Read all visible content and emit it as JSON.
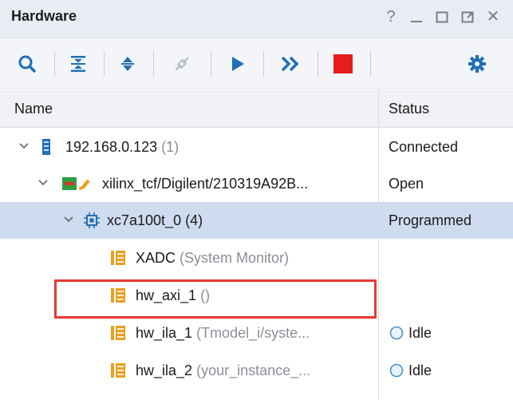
{
  "panel": {
    "title": "Hardware",
    "controls": [
      "help-icon",
      "minimize-icon",
      "maximize-icon",
      "float-icon",
      "close-icon"
    ],
    "control_glyphs": {
      "help": "?",
      "close": "✕"
    }
  },
  "toolbar": {
    "buttons": [
      "search-icon",
      "collapse-all-icon",
      "expand-all-icon",
      "auto-connect-icon",
      "run-trigger-icon",
      "run-trigger-immediate-icon",
      "stop-trigger-icon",
      "settings-icon"
    ]
  },
  "columns": {
    "name": "Name",
    "status": "Status"
  },
  "rows": [
    {
      "name": "192.168.0.123",
      "suffix": "(1)",
      "status": "Connected",
      "icon": "server-icon"
    },
    {
      "name": "xilinx_tcf/Digilent/210319A92B...",
      "suffix": "",
      "status": "Open",
      "icon": "jtag-cable-icon"
    },
    {
      "name": "xc7a100t_0",
      "suffix": "(4)",
      "status": "Programmed",
      "icon": "fpga-chip-icon",
      "selected": true
    },
    {
      "name": "XADC",
      "suffix": "(System Monitor)",
      "status": "",
      "icon": "debug-core-icon"
    },
    {
      "name": "hw_axi_1",
      "suffix": "()",
      "status": "",
      "icon": "debug-core-icon",
      "highlighted": true
    },
    {
      "name": "hw_ila_1",
      "suffix": "(Tmodel_i/syste...",
      "status": "Idle",
      "icon": "debug-core-icon"
    },
    {
      "name": "hw_ila_2",
      "suffix": "(your_instance_...",
      "status": "Idle",
      "icon": "debug-core-icon"
    }
  ],
  "colors": {
    "accent": "#1f6fb5",
    "stop": "#e81c1c",
    "selected_row": "#cfdcf0",
    "highlight": "#e53935",
    "core_icon": "#e8a020"
  }
}
